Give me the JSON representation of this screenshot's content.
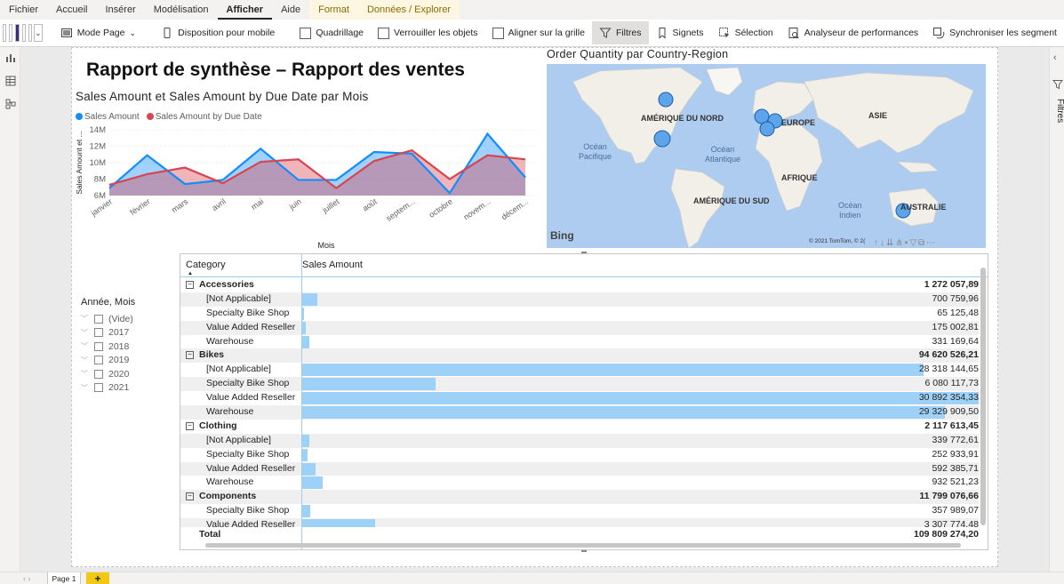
{
  "ribbon": {
    "tabs": [
      "Fichier",
      "Accueil",
      "Insérer",
      "Modélisation",
      "Afficher",
      "Aide",
      "Format",
      "Données / Explorer"
    ],
    "active_tab": "Afficher",
    "theme_label": "Aa",
    "buttons": {
      "page_view": "Mode Page",
      "mobile_layout": "Disposition pour mobile",
      "gridlines": "Quadrillage",
      "lock_objects": "Verrouiller les objets",
      "snap_grid": "Aligner sur la grille",
      "filters": "Filtres",
      "bookmarks": "Signets",
      "selection": "Sélection",
      "performance": "Analyseur de performances",
      "sync_slicers": "Synchroniser les segment"
    }
  },
  "right_pane": {
    "filters_label": "Filtres"
  },
  "report": {
    "title": "Rapport de synthèse – Rapport des ventes"
  },
  "line_chart": {
    "title": "Sales Amount et Sales Amount by Due Date par Mois",
    "legend": [
      {
        "name": "Sales Amount",
        "color": "#118dff"
      },
      {
        "name": "Sales Amount by Due Date",
        "color": "#d64550"
      }
    ],
    "ylabel": "Sales Amount et ...",
    "xlabel": "Mois",
    "yticks": [
      "14M",
      "12M",
      "10M",
      "8M",
      "6M"
    ]
  },
  "chart_data": {
    "type": "area",
    "categories": [
      "janvier",
      "février",
      "mars",
      "avril",
      "mai",
      "juin",
      "juillet",
      "août",
      "septem...",
      "octobre",
      "novem...",
      "décem..."
    ],
    "series": [
      {
        "name": "Sales Amount",
        "values": [
          6.9,
          10.9,
          7.4,
          7.9,
          11.7,
          7.9,
          7.9,
          11.3,
          11.1,
          6.3,
          13.5,
          8.2
        ]
      },
      {
        "name": "Sales Amount by Due Date",
        "values": [
          7.3,
          8.6,
          9.4,
          7.5,
          10.1,
          10.4,
          6.9,
          10.2,
          11.5,
          8.0,
          10.9,
          10.4
        ]
      }
    ],
    "xlabel": "Mois",
    "ylabel": "Sales Amount et ...",
    "ylim": [
      6,
      14
    ]
  },
  "map_visual": {
    "title": "Order Quantity par Country-Region",
    "continents": [
      "AMÉRIQUE DU NORD",
      "EUROPE",
      "ASIE",
      "AFRIQUE",
      "AMÉRIQUE DU SUD",
      "AUSTRALIE"
    ],
    "oceans": [
      "Océan\nPacifique",
      "Océan\nAtlantique",
      "Océan\nIndien"
    ],
    "provider": "Bing",
    "copyright": "© 2021 TomTom, © 2("
  },
  "slicer": {
    "title": "Année, Mois",
    "items": [
      "(Vide)",
      "2017",
      "2018",
      "2019",
      "2020",
      "2021"
    ]
  },
  "matrix": {
    "col_category": "Category",
    "col_value": "Sales Amount",
    "max_value": 30892354.33,
    "rows": [
      {
        "label": "Accessories",
        "value": "1 272 057,89",
        "group": true,
        "n": 0
      },
      {
        "label": "[Not Applicable]",
        "value": "700 759,96",
        "n": 700759.96
      },
      {
        "label": "Specialty Bike Shop",
        "value": "65 125,48",
        "n": 65125.48
      },
      {
        "label": "Value Added Reseller",
        "value": "175 002,81",
        "n": 175002.81
      },
      {
        "label": "Warehouse",
        "value": "331 169,64",
        "n": 331169.64
      },
      {
        "label": "Bikes",
        "value": "94 620 526,21",
        "group": true,
        "n": 0
      },
      {
        "label": "[Not Applicable]",
        "value": "28 318 144,65",
        "n": 28318144.65
      },
      {
        "label": "Specialty Bike Shop",
        "value": "6 080 117,73",
        "n": 6080117.73
      },
      {
        "label": "Value Added Reseller",
        "value": "30 892 354,33",
        "n": 30892354.33
      },
      {
        "label": "Warehouse",
        "value": "29 329 909,50",
        "n": 29329909.5
      },
      {
        "label": "Clothing",
        "value": "2 117 613,45",
        "group": true,
        "n": 0
      },
      {
        "label": "[Not Applicable]",
        "value": "339 772,61",
        "n": 339772.61
      },
      {
        "label": "Specialty Bike Shop",
        "value": "252 933,91",
        "n": 252933.91
      },
      {
        "label": "Value Added Reseller",
        "value": "592 385,71",
        "n": 592385.71
      },
      {
        "label": "Warehouse",
        "value": "932 521,23",
        "n": 932521.23
      },
      {
        "label": "Components",
        "value": "11 799 076,66",
        "group": true,
        "n": 0
      },
      {
        "label": "Specialty Bike Shop",
        "value": "357 989,07",
        "n": 357989.07
      },
      {
        "label": "Value Added Reseller",
        "value": "3 307 774,48",
        "n": 3307774.48
      }
    ],
    "total_label": "Total",
    "total_value": "109 809 274,20"
  },
  "pages": {
    "tab": "Page 1",
    "add": "+"
  }
}
